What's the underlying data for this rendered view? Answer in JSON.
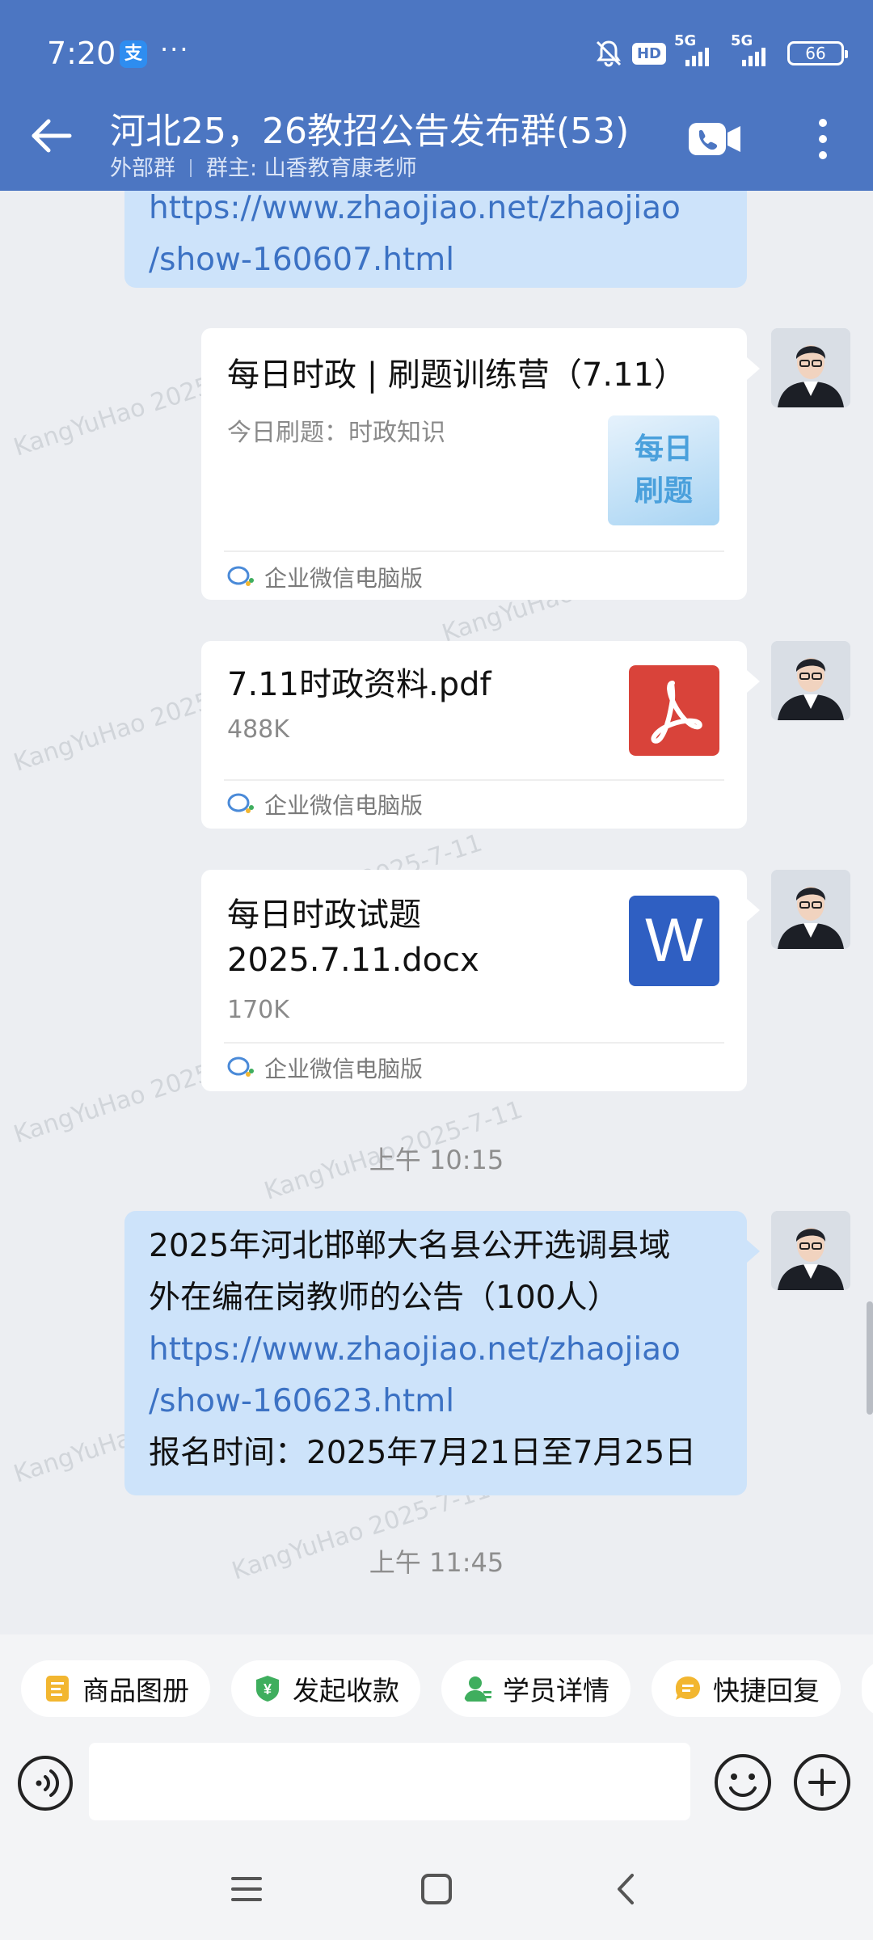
{
  "status_bar": {
    "time": "7:20",
    "alipay_icon_text": "支",
    "more": "···",
    "hd": "HD",
    "sim1": "5G",
    "sim2": "5G",
    "battery": "66"
  },
  "header": {
    "title": "河北25，26教招公告发布群(53)",
    "subtitle_left": "外部群",
    "subtitle_owner": "群主: 山香教育康老师",
    "icons": [
      "back-arrow-icon",
      "video-call-icon",
      "more-vertical-icon"
    ]
  },
  "watermark": "KangYuHao 2025-7-11",
  "messages": {
    "partial_link": {
      "line1": "https://www.zhaojiao.net/zhaojiao",
      "line2": "/show-160607.html"
    },
    "card1": {
      "title": "每日时政 | 刷题训练营（7.11）",
      "desc": "今日刷题：时政知识",
      "thumb_line1": "每日",
      "thumb_line2": "刷题",
      "source": "企业微信电脑版"
    },
    "file1": {
      "name": "7.11时政资料.pdf",
      "size": "488K",
      "source": "企业微信电脑版",
      "icon": "pdf-icon"
    },
    "file2": {
      "name_line1": "每日时政试题",
      "name_line2": "2025.7.11.docx",
      "size": "170K",
      "source": "企业微信电脑版",
      "icon_text": "W"
    },
    "time1": "上午 10:15",
    "text_msg": {
      "line1": "2025年河北邯郸大名县公开选调县域",
      "line2": "外在编在岗教师的公告（100人）",
      "link_line1": "https://www.zhaojiao.net/zhaojiao",
      "link_line2": "/show-160623.html",
      "line5": "报名时间：2025年7月21日至7月25日"
    },
    "time2": "上午 11:45"
  },
  "quick_actions": [
    {
      "label": "商品图册",
      "color": "#f2b630"
    },
    {
      "label": "发起收款",
      "color": "#3fae5e"
    },
    {
      "label": "学员详情",
      "color": "#3fae5e"
    },
    {
      "label": "快捷回复",
      "color": "#f2b630"
    }
  ],
  "input": {
    "placeholder": ""
  },
  "colors": {
    "header": "#4c76c2",
    "bubble": "#cde3fa",
    "link": "#3c72c4",
    "pdf": "#d9433a",
    "word": "#2f5fc2"
  }
}
